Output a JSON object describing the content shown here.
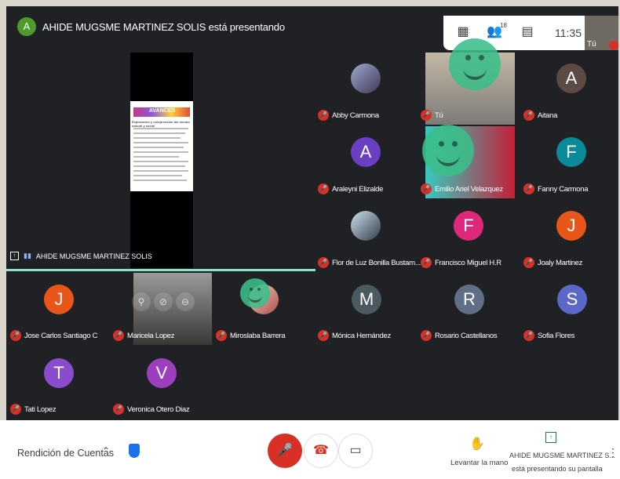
{
  "header": {
    "presenter_initial": "A",
    "presenter_banner": "AHIDE MUGSME MARTINEZ SOLIS está presentando",
    "participants_count": "18",
    "clock": "11:35",
    "self_label": "Tú"
  },
  "presentation": {
    "slide_title": "AVANCES",
    "slide_subtitle": "Exploración y comprensión del mundo natural y social",
    "presenter_label": "AHIDE MUGSME MARTINEZ SOLIS"
  },
  "participants": [
    {
      "name": "Abby Carmona",
      "initial": "",
      "color": ""
    },
    {
      "name": "Tú",
      "initial": "",
      "color": ""
    },
    {
      "name": "Aitana",
      "initial": "A",
      "color": "#5c4a45"
    },
    {
      "name": "Araleyni Elizalde",
      "initial": "A",
      "color": "#6a3fc4"
    },
    {
      "name": "Emilio Ariel Velazquez",
      "initial": "",
      "color": ""
    },
    {
      "name": "Fanny Carmona",
      "initial": "F",
      "color": "#0b8a9a"
    },
    {
      "name": "Flor de Luz Bonilla Bustam...",
      "initial": "",
      "color": ""
    },
    {
      "name": "Francisco Miguel H.R",
      "initial": "F",
      "color": "#e0287a"
    },
    {
      "name": "Joaly Martinez",
      "initial": "J",
      "color": "#e8561a"
    },
    {
      "name": "Jose Carlos Santiago C",
      "initial": "J",
      "color": "#e8561a"
    },
    {
      "name": "Maricela Lopez",
      "initial": "",
      "color": ""
    },
    {
      "name": "Miroslaba Barrera",
      "initial": "",
      "color": ""
    },
    {
      "name": "Mónica Hernández",
      "initial": "M",
      "color": "#4a5a60"
    },
    {
      "name": "Rosario Castellanos",
      "initial": "R",
      "color": "#5f7086"
    },
    {
      "name": "Sofia Flores",
      "initial": "S",
      "color": "#5b67c9"
    },
    {
      "name": "Tati Lopez",
      "initial": "T",
      "color": "#8a4ccc"
    },
    {
      "name": "Veronica Otero Diaz",
      "initial": "V",
      "color": "#9b3fbf"
    }
  ],
  "bottom": {
    "meeting_name": "Rendición de Cuentas",
    "raise_hand": "Levantar la mano",
    "presenting_name": "AHIDE MUGSME MARTINEZ S...",
    "presenting_status": "está presentando su pantalla"
  }
}
